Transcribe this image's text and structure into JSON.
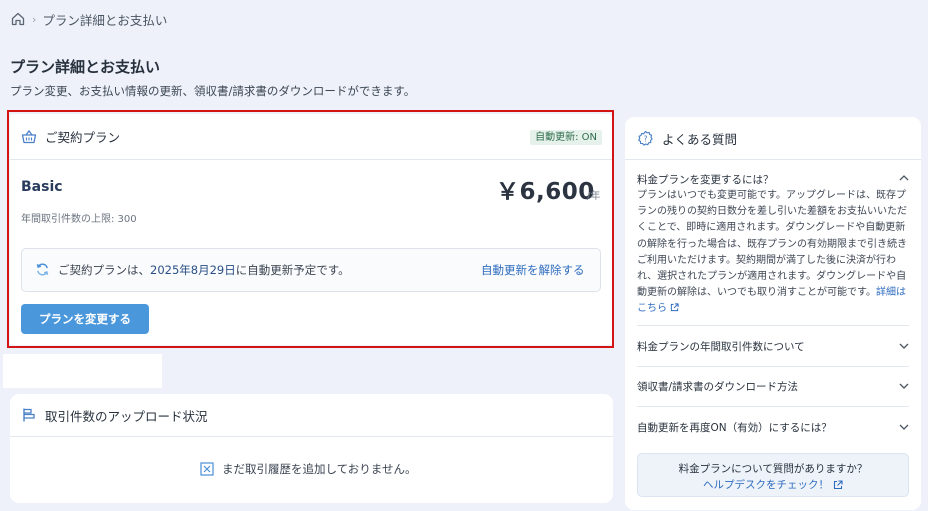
{
  "breadcrumb": {
    "icon": "home-icon",
    "current": "プラン詳細とお支払い"
  },
  "page": {
    "title": "プラン詳細とお支払い",
    "description": "プラン変更、お支払い情報の更新、領収書/請求書のダウンロードができます。"
  },
  "plan_card": {
    "title": "ご契約プラン",
    "icon": "basket-icon",
    "status_badge": "自動更新: ON",
    "plan_name": "Basic",
    "price": "￥6,600",
    "price_unit": "/年",
    "limit_text": "年間取引件数の上限: 300",
    "renew_prefix": "ご契約プランは、",
    "renew_date": "2025年8月29日",
    "renew_suffix": "に自動更新予定です。",
    "cancel_link": "自動更新を解除する",
    "change_button": "プランを変更する"
  },
  "upload_card": {
    "title": "取引件数のアップロード状況",
    "empty_message": "まだ取引履歴を追加しておりません。"
  },
  "faq": {
    "title": "よくある質問",
    "items": [
      {
        "question": "料金プランを変更するには？",
        "expanded": true,
        "answer": "プランはいつでも変更可能です。アップグレードは、既存プランの残りの契約日数分を差し引いた差額をお支払いいただくことで、即時に適用されます。ダウングレードや自動更新の解除を行った場合は、既存プランの有効期限まで引き続きご利用いただけます。契約期間が満了した後に決済が行われ、選択されたプランが適用されます。ダウングレードや自動更新の解除は、いつでも取り消すことが可能です。",
        "link": "詳細はこちら"
      },
      {
        "question": "料金プランの年間取引件数について",
        "expanded": false
      },
      {
        "question": "領収書/請求書のダウンロード方法",
        "expanded": false
      },
      {
        "question": "自動更新を再度ON（有効）にするには？",
        "expanded": false
      }
    ],
    "help_question": "料金プランについて質問がありますか？",
    "help_link": "ヘルプデスクをチェック！"
  },
  "colors": {
    "accent": "#4a97dc",
    "link": "#2d6bbf",
    "highlight": "#d41414",
    "badge_bg": "#e5f1ea"
  }
}
